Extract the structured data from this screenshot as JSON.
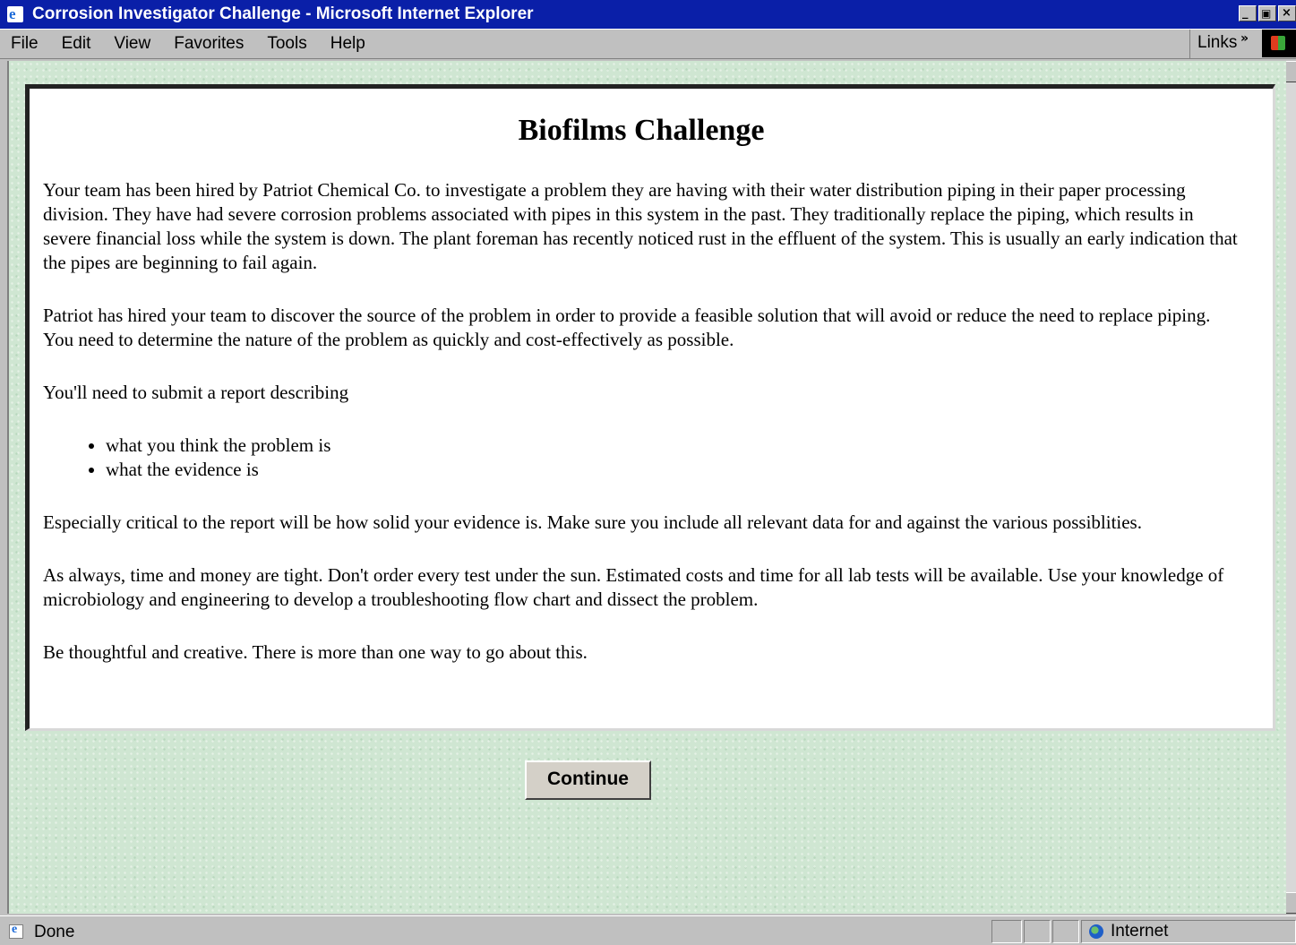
{
  "window": {
    "title": "Corrosion Investigator Challenge - Microsoft Internet Explorer",
    "minimize_glyph": "_",
    "maximize_glyph": "▣",
    "close_glyph": "×"
  },
  "menu": {
    "items": [
      {
        "label": "File"
      },
      {
        "label": "Edit"
      },
      {
        "label": "View"
      },
      {
        "label": "Favorites"
      },
      {
        "label": "Tools"
      },
      {
        "label": "Help"
      }
    ],
    "links_label": "Links",
    "links_chevron": "»"
  },
  "page": {
    "heading": "Biofilms Challenge",
    "paragraphs": [
      "Your team has been hired by Patriot Chemical Co. to investigate a problem they are having with their water distribution piping in their paper processing division. They have had severe corrosion problems associated with pipes in this system in the past. They traditionally replace the piping, which results in severe financial loss while the system is down. The plant foreman has recently noticed rust in the effluent of the system. This is usually an early indication that the pipes are beginning to fail again.",
      "Patriot has hired your team to discover the source of the problem in order to provide a feasible solution that will avoid or reduce the need to replace piping. You need to determine the nature of the problem as quickly and cost-effectively as possible.",
      "You'll need to submit a report describing"
    ],
    "bullets": [
      "what you think the problem is",
      "what the evidence is"
    ],
    "paragraphs_after": [
      "Especially critical to the report will be how solid your evidence is. Make sure you include all relevant data for and against the various possiblities.",
      "As always, time and money are tight. Don't order every test under the sun. Estimated costs and time for all lab tests will be available. Use your knowledge of microbiology and engineering to develop a troubleshooting flow chart and dissect the problem.",
      "Be thoughtful and creative. There is more than one way to go about this."
    ],
    "continue_label": "Continue"
  },
  "status": {
    "text": "Done",
    "zone": "Internet"
  },
  "colors": {
    "titlebar": "#0a1fa8",
    "page_background": "#cfe6d2",
    "chrome": "#c0c0c0"
  },
  "icons": {
    "title_icon": "ie-logo-icon",
    "status_icon": "page-icon",
    "zone_icon": "globe-icon",
    "windows_logo": "windows-logo-icon"
  }
}
